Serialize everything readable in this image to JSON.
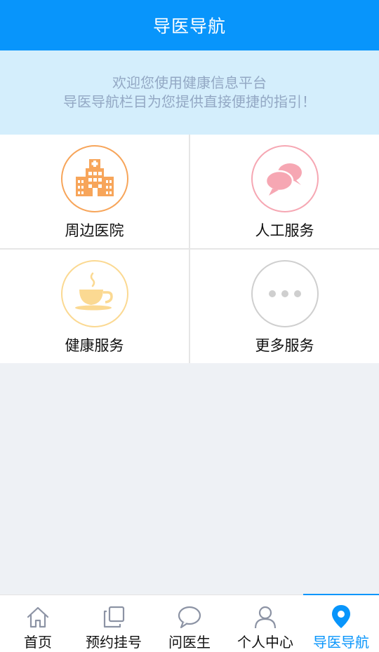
{
  "header": {
    "title": "导医导航"
  },
  "banner": {
    "line1": "欢迎您使用健康信息平台",
    "line2": "导医导航栏目为您提供直接便捷的指引！"
  },
  "services": [
    {
      "label": "周边医院",
      "icon": "hospital-icon",
      "color": "#f7a55a"
    },
    {
      "label": "人工服务",
      "icon": "chat-bubbles-icon",
      "color": "#f6a7b3"
    },
    {
      "label": "健康服务",
      "icon": "tea-cup-icon",
      "color": "#fbd992"
    },
    {
      "label": "更多服务",
      "icon": "more-dots-icon",
      "color": "#cfcfcf"
    }
  ],
  "tabbar": {
    "active": "导医导航",
    "items": [
      {
        "label": "首页",
        "icon": "home-icon"
      },
      {
        "label": "预约挂号",
        "icon": "copy-squares-icon"
      },
      {
        "label": "问医生",
        "icon": "speech-bubble-icon"
      },
      {
        "label": "个人中心",
        "icon": "person-icon"
      },
      {
        "label": "导医导航",
        "icon": "location-pin-icon"
      }
    ]
  },
  "colors": {
    "primary": "#0895fb",
    "banner_bg": "#d4eefc",
    "banner_text": "#93a8c4",
    "page_bg": "#eef1f5"
  }
}
